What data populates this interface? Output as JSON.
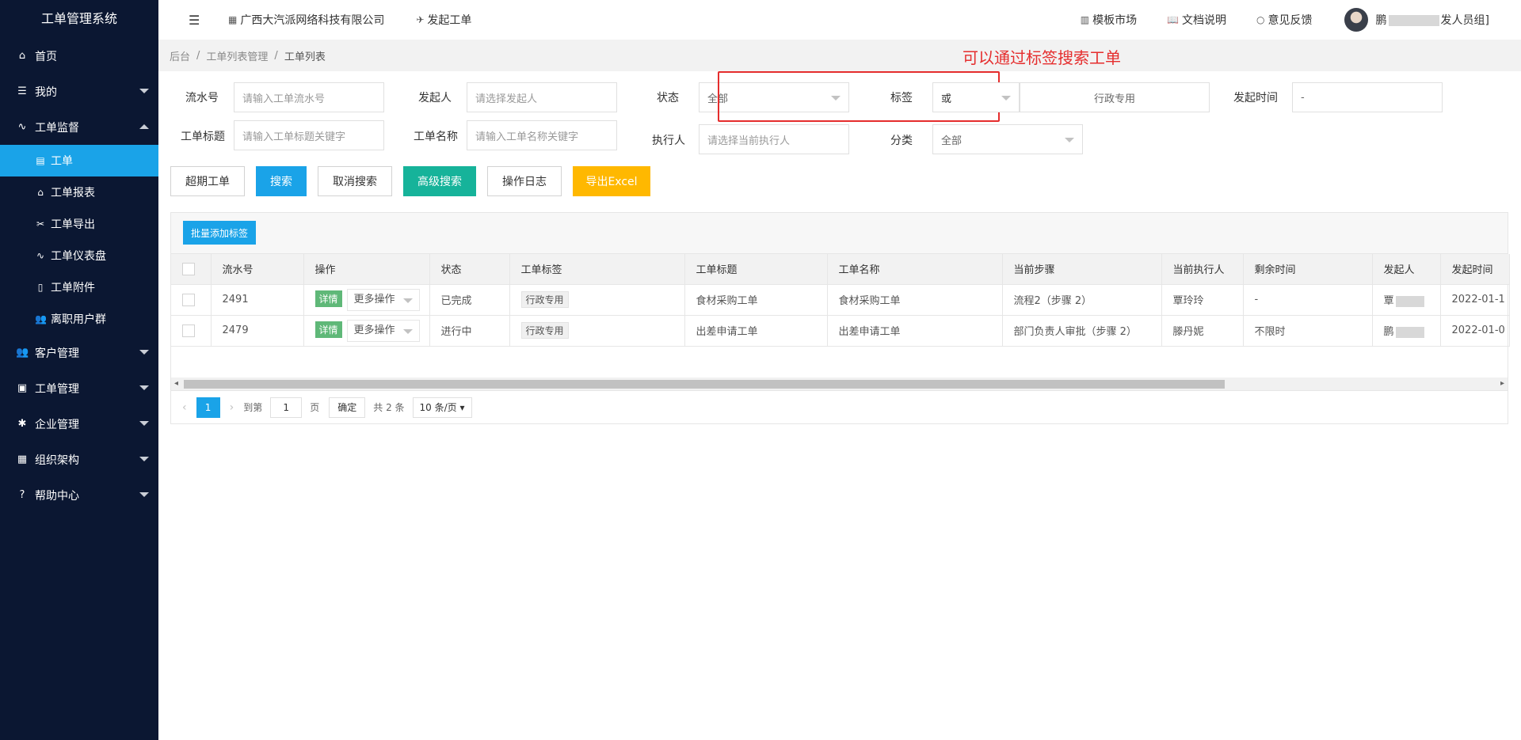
{
  "app": {
    "title": "工单管理系统"
  },
  "sidebar": {
    "items": [
      {
        "label": "首页",
        "icon": "home-icon"
      },
      {
        "label": "我的",
        "icon": "layers-icon"
      },
      {
        "label": "工单监督",
        "icon": "pulse-icon"
      },
      {
        "label": "客户管理",
        "icon": "users-icon"
      },
      {
        "label": "工单管理",
        "icon": "clipboard-icon"
      },
      {
        "label": "企业管理",
        "icon": "gear-icon"
      },
      {
        "label": "组织架构",
        "icon": "calendar-icon"
      },
      {
        "label": "帮助中心",
        "icon": "question-icon"
      }
    ],
    "sub": [
      {
        "label": "工单",
        "icon": "document-icon"
      },
      {
        "label": "工单报表",
        "icon": "home-icon"
      },
      {
        "label": "工单导出",
        "icon": "export-icon"
      },
      {
        "label": "工单仪表盘",
        "icon": "pulse-icon"
      },
      {
        "label": "工单附件",
        "icon": "file-icon"
      },
      {
        "label": "离职用户群",
        "icon": "users-icon"
      }
    ]
  },
  "header": {
    "company": "广西大汽派网络科技有限公司",
    "start": "发起工单",
    "template": "模板市场",
    "docs": "文档说明",
    "feedback": "意见反馈",
    "user_prefix": "鹏",
    "user_suffix": "发人员组]"
  },
  "breadcrumb": [
    "后台",
    "工单列表管理",
    "工单列表"
  ],
  "annotation": "可以通过标签搜索工单",
  "filters": {
    "serial_label": "流水号",
    "serial_ph": "请输入工单流水号",
    "initiator_label": "发起人",
    "initiator_ph": "请选择发起人",
    "status_label": "状态",
    "status_val": "全部",
    "tag_label": "标签",
    "tag_mode": "或",
    "tag_val": "行政专用",
    "time_label": "发起时间",
    "time_val": "-",
    "title_label": "工单标题",
    "title_ph": "请输入工单标题关键字",
    "name_label": "工单名称",
    "name_ph": "请输入工单名称关键字",
    "executor_label": "执行人",
    "executor_ph": "请选择当前执行人",
    "category_label": "分类",
    "category_val": "全部"
  },
  "buttons": {
    "overdue": "超期工单",
    "search": "搜索",
    "cancel": "取消搜索",
    "advanced": "高级搜索",
    "log": "操作日志",
    "export": "导出Excel",
    "batch_tag": "批量添加标签"
  },
  "table": {
    "headers": [
      "流水号",
      "操作",
      "状态",
      "工单标签",
      "工单标题",
      "工单名称",
      "当前步骤",
      "当前执行人",
      "剩余时间",
      "发起人",
      "发起时间"
    ],
    "detail_label": "详情",
    "more_label": "更多操作",
    "rows": [
      {
        "serial": "2491",
        "status": "已完成",
        "tag": "行政专用",
        "title": "食材采购工单",
        "name": "食材采购工单",
        "step": "流程2（步骤 2）",
        "executor": "覃玲玲",
        "remain": "-",
        "initiator": "覃",
        "time": "2022-01-1"
      },
      {
        "serial": "2479",
        "status": "进行中",
        "tag": "行政专用",
        "title": "出差申请工单",
        "name": "出差申请工单",
        "step": "部门负责人审批（步骤 2）",
        "executor": "滕丹妮",
        "remain": "不限时",
        "initiator": "鹏",
        "time": "2022-01-0"
      }
    ]
  },
  "pager": {
    "current": "1",
    "goto": "到第",
    "page_input": "1",
    "page_unit": "页",
    "confirm": "确定",
    "total": "共 2 条",
    "size": "10 条/页 ▾"
  }
}
